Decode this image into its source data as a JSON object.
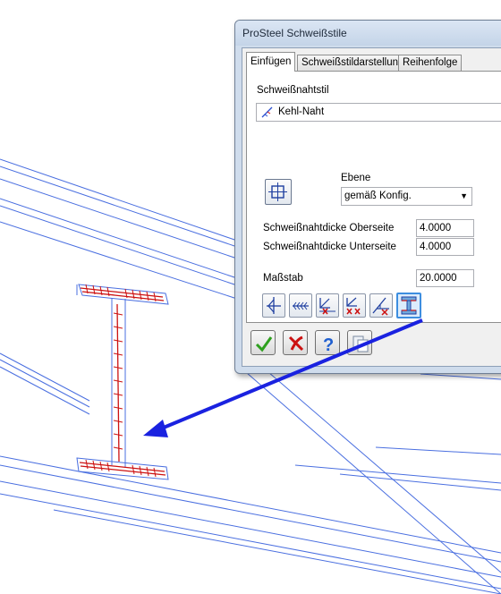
{
  "dialog": {
    "title": "ProSteel Schweißstile",
    "tabs": [
      {
        "label": "Einfügen",
        "active": true
      },
      {
        "label": "Schweißstildarstellung",
        "active": false
      },
      {
        "label": "Reihenfolge",
        "active": false
      }
    ],
    "weld_style": {
      "label": "Schweißnahtstil",
      "selected": "Kehl-Naht",
      "icon": "fillet-weld-icon"
    },
    "plane": {
      "label": "Ebene",
      "selected": "gemäß Konfig."
    },
    "fields": [
      {
        "label": "Schweißnahtdicke Oberseite",
        "value": "4.0000"
      },
      {
        "label": "Schweißnahtdicke Unterseite",
        "value": "4.0000"
      },
      {
        "label": "Maßstab",
        "value": "20.0000"
      }
    ],
    "tool_buttons": [
      {
        "icon": "weld-symbol-side-icon"
      },
      {
        "icon": "weld-line-icon"
      },
      {
        "icon": "weld-delete-icon"
      },
      {
        "icon": "weld-delete-multiple-icon"
      },
      {
        "icon": "weld-delete-symbol-icon"
      },
      {
        "icon": "i-beam-profile-icon",
        "selected": true
      }
    ],
    "bottom_buttons": [
      {
        "icon": "checkmark-icon"
      },
      {
        "icon": "cancel-icon"
      },
      {
        "icon": "help-icon"
      },
      {
        "icon": "copy-icon"
      }
    ]
  },
  "colors": {
    "model_lines": "#4a6fe0",
    "weld_marks": "#cc1111",
    "arrow": "#1a22e0",
    "accept_green": "#2ea01e",
    "cancel_red": "#cc1111",
    "help_blue": "#1f5fd0"
  }
}
